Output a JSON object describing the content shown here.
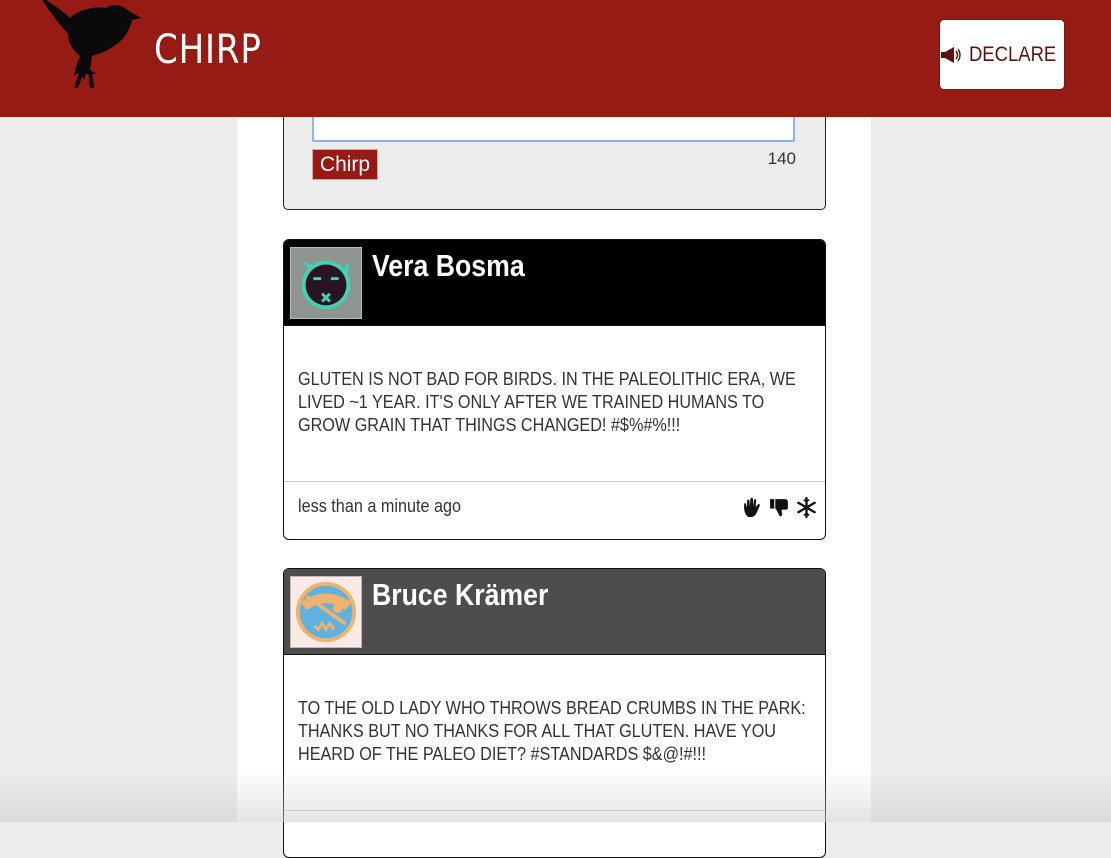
{
  "header": {
    "app_name": "CHIRP",
    "declare_label": "DECLARE",
    "background": "#951b14"
  },
  "composer": {
    "textarea_value": "",
    "button_label": "Chirp",
    "char_count": "140"
  },
  "posts": [
    {
      "author": "Vera Bosma",
      "header_color": "#000000",
      "avatar_icon": "teal-x-face-avatar-icon",
      "text": "GLUTEN IS NOT BAD FOR BIRDS. IN THE PALEOLITHIC ERA, WE LIVED ~1 YEAR. IT'S ONLY AFTER WE TRAINED HUMANS TO GROW GRAIN THAT THINGS CHANGED! #$%#%!!!",
      "time": "less than a minute ago",
      "actions": [
        "hand-icon",
        "thumbs-down-icon",
        "snowflake-icon"
      ]
    },
    {
      "author": "Bruce Krämer",
      "header_color": "#4d4d4d",
      "avatar_icon": "blue-pirate-face-avatar-icon",
      "text": "TO THE OLD LADY WHO THROWS BREAD CRUMBS IN THE PARK: THANKS BUT NO THANKS FOR ALL THAT GLUTEN. HAVE YOU HEARD OF THE PALEO DIET? #STANDARDS $&@!#!!!"
    }
  ]
}
